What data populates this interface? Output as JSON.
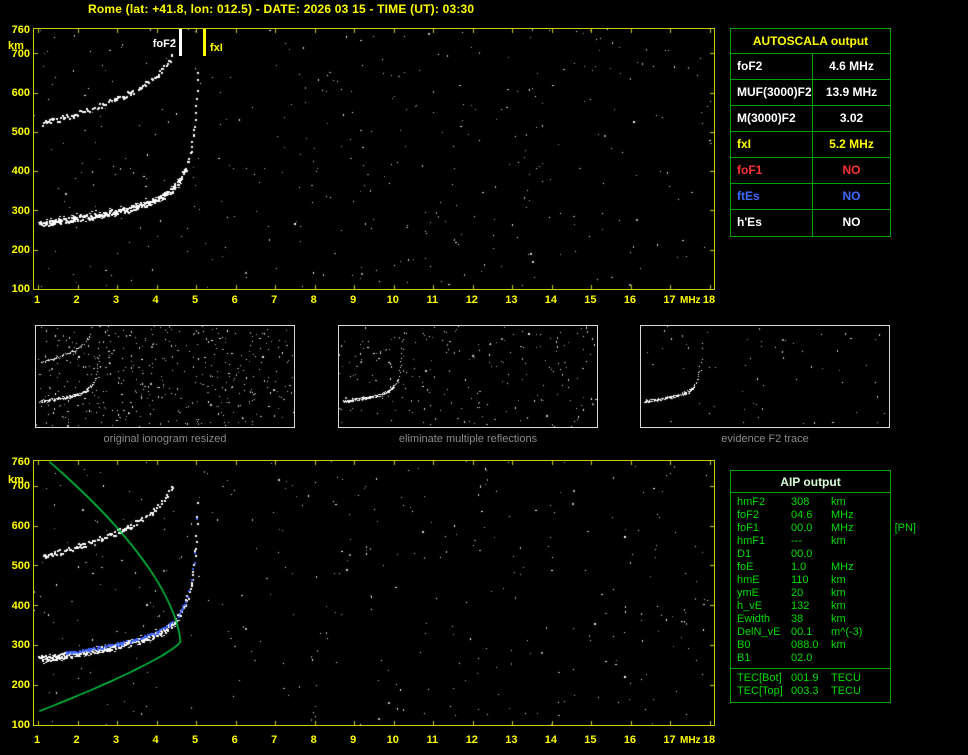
{
  "header": {
    "title": "Rome (lat: +41.8, lon: 012.5) - DATE: 2026 03 15 - TIME (UT): 03:30"
  },
  "colors": {
    "background": "#000000",
    "title_yellow": "#ffff00",
    "axis_yellow": "#cccc00",
    "table_border_green": "#00a300",
    "aip_text_green": "#00dd00",
    "status_red": "#ff3232",
    "status_blue": "#4169ff",
    "marker_white": "#ffffff",
    "profile_green": "#00cc44",
    "trace_blue": "#4466ff",
    "caption_gray": "#8a8a8a"
  },
  "axes": {
    "y_unit": "km",
    "x_unit": "MHz",
    "y_ticks": [
      "760",
      "700",
      "600",
      "500",
      "400",
      "300",
      "200",
      "100"
    ],
    "x_ticks": [
      "1",
      "2",
      "3",
      "4",
      "5",
      "6",
      "7",
      "8",
      "9",
      "10",
      "11",
      "12",
      "13",
      "14",
      "15",
      "16",
      "17",
      "18"
    ]
  },
  "markers": {
    "fof2": "foF2",
    "fxi": "fxI",
    "fof2_mhz": 4.6,
    "fxi_mhz": 5.2
  },
  "autoscala": {
    "title": "AUTOSCALA output",
    "rows": [
      {
        "label": "foF2",
        "value": "4.6 MHz",
        "color": "white"
      },
      {
        "label": "MUF(3000)F2",
        "value": "13.9 MHz",
        "color": "white"
      },
      {
        "label": "M(3000)F2",
        "value": "3.02",
        "color": "white"
      },
      {
        "label": "fxI",
        "value": "5.2 MHz",
        "color": "yellow"
      },
      {
        "label": "foF1",
        "value": "NO",
        "color": "red"
      },
      {
        "label": "ftEs",
        "value": "NO",
        "color": "blue"
      },
      {
        "label": "h'Es",
        "value": "NO",
        "color": "white"
      }
    ]
  },
  "thumbnails": [
    {
      "caption": "original ionogram resized"
    },
    {
      "caption": "eliminate multiple reflections"
    },
    {
      "caption": "evidence F2 trace"
    }
  ],
  "aip": {
    "title": "AIP output",
    "rows": [
      {
        "label": "hmF2",
        "value": "308",
        "unit": "km"
      },
      {
        "label": "foF2",
        "value": "04.6",
        "unit": "MHz"
      },
      {
        "label": "foF1",
        "value": "00.0",
        "unit": "MHz",
        "note": "[PN]"
      },
      {
        "label": "hmF1",
        "value": "---",
        "unit": "km"
      },
      {
        "label": "D1",
        "value": "00.0",
        "unit": ""
      },
      {
        "label": "foE",
        "value": "1.0",
        "unit": "MHz"
      },
      {
        "label": "hmE",
        "value": "110",
        "unit": "km"
      },
      {
        "label": "ymE",
        "value": "20",
        "unit": "km"
      },
      {
        "label": "h_vE",
        "value": "132",
        "unit": "km"
      },
      {
        "label": "Ewidth",
        "value": "38",
        "unit": "km"
      },
      {
        "label": "DelN_vE",
        "value": "00.1",
        "unit": "m^(-3)"
      },
      {
        "label": "B0",
        "value": "088.0",
        "unit": "km"
      },
      {
        "label": "B1",
        "value": "02.0",
        "unit": ""
      }
    ],
    "tec_rows": [
      {
        "label": "TEC[Bot]",
        "value": "001.9",
        "unit": "TECU"
      },
      {
        "label": "TEC[Top]",
        "value": "003.3",
        "unit": "TECU"
      }
    ]
  }
}
